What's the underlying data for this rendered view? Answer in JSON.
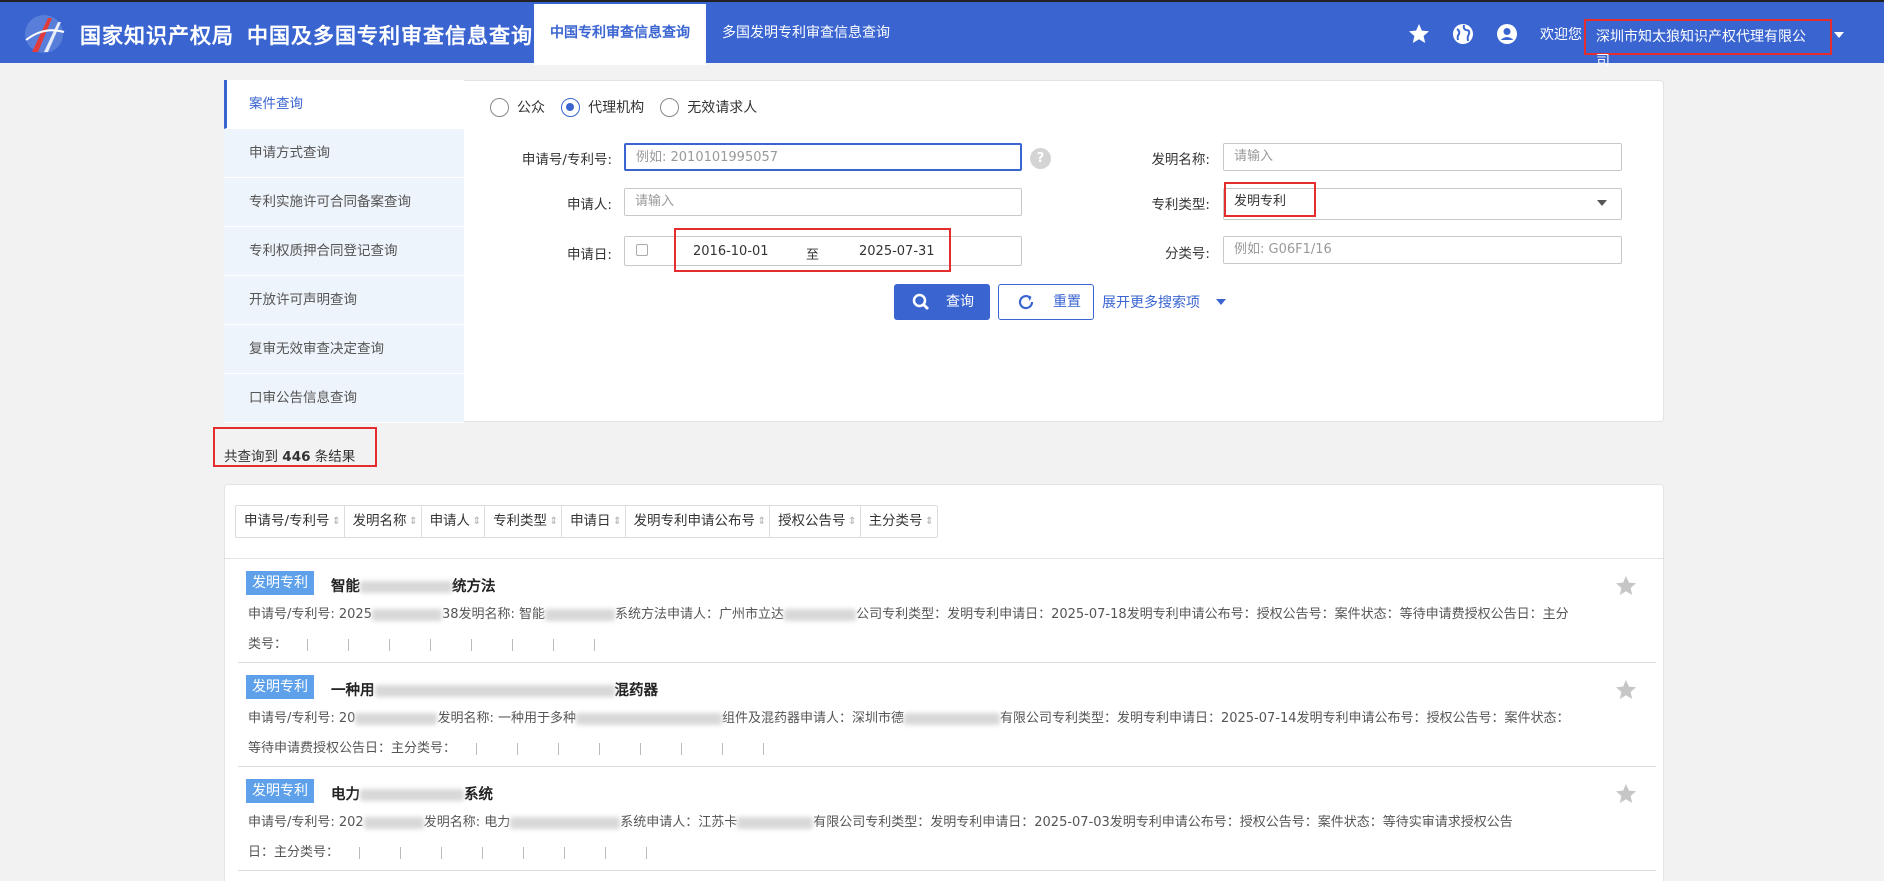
{
  "header": {
    "brand": "国家知识产权局",
    "system_title": "中国及多国专利审查信息查询",
    "tabs": [
      {
        "label": "中国专利审查信息查询",
        "active": true
      },
      {
        "label": "多国发明专利审查信息查询",
        "active": false
      }
    ],
    "icons": [
      "star-icon",
      "globe-icon",
      "account-icon"
    ],
    "welcome": "欢迎您",
    "company": "深圳市知太狼知识产权代理有限公司"
  },
  "sidebar": {
    "items": [
      {
        "label": "案件查询",
        "active": true
      },
      {
        "label": "申请方式查询"
      },
      {
        "label": "专利实施许可合同备案查询"
      },
      {
        "label": "专利权质押合同登记查询"
      },
      {
        "label": "开放许可声明查询"
      },
      {
        "label": "复审无效审查决定查询"
      },
      {
        "label": "口审公告信息查询"
      }
    ]
  },
  "search": {
    "roles": [
      "公众",
      "代理机构",
      "无效请求人"
    ],
    "selected_role": "代理机构",
    "app_no_label": "申请号/专利号:",
    "app_no_placeholder": "例如: 2010101995057",
    "invention_label": "发明名称:",
    "invention_placeholder": "请输入",
    "applicant_label": "申请人:",
    "applicant_placeholder": "请输入",
    "type_label": "专利类型:",
    "type_value": "发明专利",
    "date_label": "申请日:",
    "date_from": "2016-10-01",
    "date_sep": "至",
    "date_to": "2025-07-31",
    "class_label": "分类号:",
    "class_placeholder": "例如:  G06F1/16",
    "search_button": "查询",
    "reset_button": "重置",
    "more_link": "展开更多搜索项"
  },
  "results": {
    "count_prefix": "共查询到",
    "count": "446",
    "count_suffix": "条结果",
    "columns": [
      "申请号/专利号",
      "发明名称",
      "申请人",
      "专利类型",
      "申请日",
      "发明专利申请公布号",
      "授权公告号",
      "主分类号"
    ],
    "items": [
      {
        "badge": "发明专利",
        "title_start": "智能",
        "title_end": "统方法",
        "line1": {
          "a": "申请号/专利号:  2025",
          "b": "38发明名称:  智能",
          "c": "系统方法申请人：广州市立达",
          "d": "公司专利类型：发明专利申请日：2025-07-18发明专利申请公布号：授权公告号：案件状态：等待申请费授权公告日：主分"
        },
        "line2": "类号："
      },
      {
        "badge": "发明专利",
        "title_start": "一种用",
        "title_end": "混药器",
        "line1": {
          "a": "申请号/专利号:  20",
          "b": "发明名称:  一种用于多种",
          "c": "组件及混药器申请人：深圳市德",
          "d": "有限公司专利类型：发明专利申请日：2025-07-14发明专利申请公布号：授权公告号：案件状态："
        },
        "line2": "等待申请费授权公告日：主分类号："
      },
      {
        "badge": "发明专利",
        "title_start": "电力",
        "title_end": "系统",
        "line1": {
          "a": "申请号/专利号:  202",
          "b": "发明名称:  电力",
          "c": "系统申请人：江苏卡",
          "d": "有限公司专利类型：发明专利申请日：2025-07-03发明专利申请公布号：授权公告号：案件状态：等待实审请求授权公告"
        },
        "line2": "日：主分类号："
      }
    ]
  },
  "colors": {
    "primary": "#3a65d1",
    "highlight_box": "#e52d2d",
    "badge": "#5ea1ea"
  }
}
